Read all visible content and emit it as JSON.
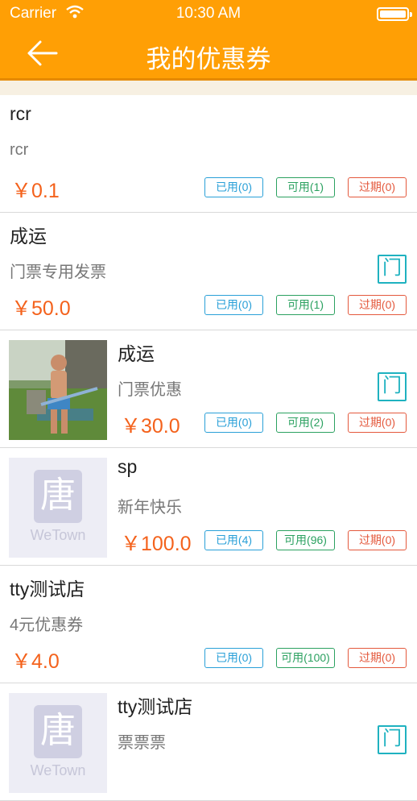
{
  "status_bar": {
    "carrier": "Carrier",
    "time": "10:30 AM"
  },
  "nav": {
    "title": "我的优惠券"
  },
  "coupons": [
    {
      "name": "rcr",
      "desc": "rcr",
      "price": "￥0.1",
      "used": "已用(0)",
      "available": "可用(1)",
      "expired": "过期(0)",
      "door_icon": "",
      "thumb": "none"
    },
    {
      "name": "成运",
      "desc": "门票专用发票",
      "price": "￥50.0",
      "used": "已用(0)",
      "available": "可用(1)",
      "expired": "过期(0)",
      "door_icon": "门",
      "thumb": "none"
    },
    {
      "name": "成运",
      "desc": "门票优惠",
      "price": "￥30.0",
      "used": "已用(0)",
      "available": "可用(2)",
      "expired": "过期(0)",
      "door_icon": "门",
      "thumb": "photo"
    },
    {
      "name": "sp",
      "desc": "新年快乐",
      "price": "￥100.0",
      "used": "已用(4)",
      "available": "可用(96)",
      "expired": "过期(0)",
      "door_icon": "",
      "thumb": "placeholder",
      "placeholder_text": "WeTown"
    },
    {
      "name": "tty测试店",
      "desc": "4元优惠券",
      "price": "￥4.0",
      "used": "已用(0)",
      "available": "可用(100)",
      "expired": "过期(0)",
      "door_icon": "",
      "thumb": "none"
    },
    {
      "name": "tty测试店",
      "desc": "票票票",
      "price": "",
      "used": "",
      "available": "",
      "expired": "",
      "door_icon": "门",
      "thumb": "placeholder",
      "placeholder_text": "WeTown"
    }
  ],
  "colors": {
    "header": "#ff9f05",
    "price": "#f4621c",
    "used": "#2aa0d8",
    "available": "#2ba160",
    "expired": "#e4593d",
    "door": "#1fb2c0"
  }
}
